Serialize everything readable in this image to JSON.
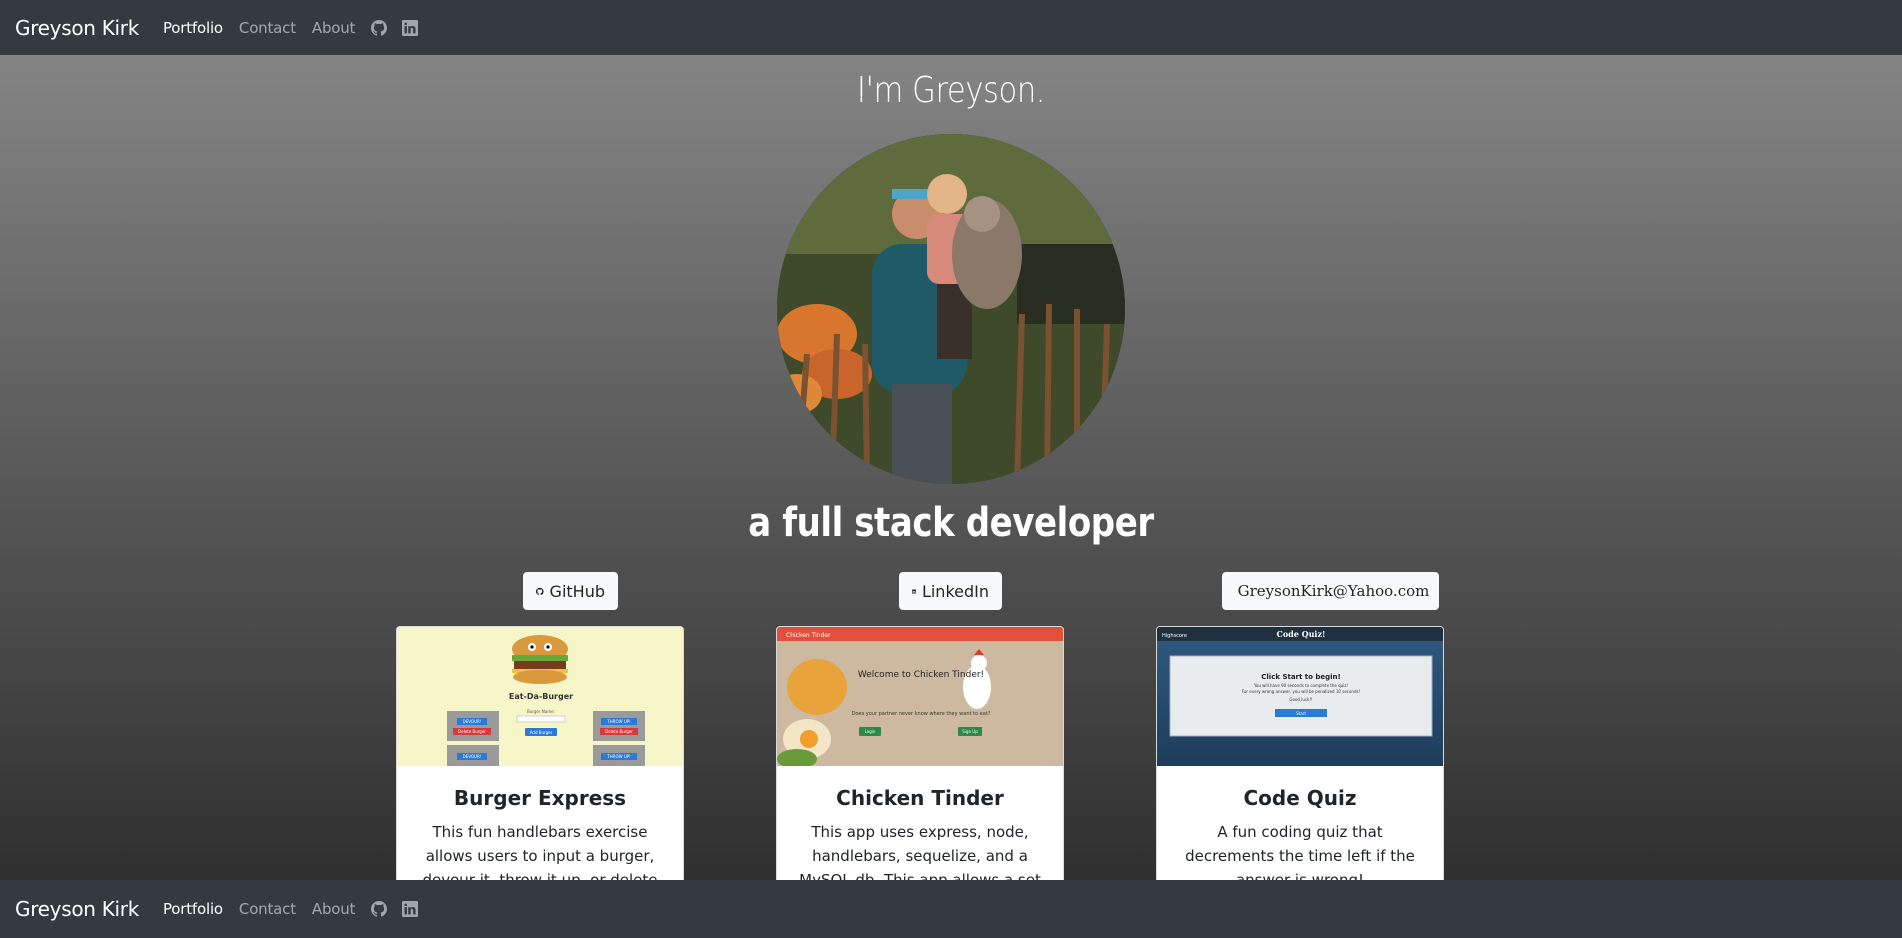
{
  "nav": {
    "brand": "Greyson Kirk",
    "links": [
      {
        "label": "Portfolio",
        "active": true
      },
      {
        "label": "Contact",
        "active": false
      },
      {
        "label": "About",
        "active": false
      }
    ],
    "icons": [
      "github-icon",
      "linkedin-icon"
    ]
  },
  "hero": {
    "title": "I'm Greyson.",
    "subtitle": "a full stack developer"
  },
  "buttons": {
    "github": "GitHub",
    "linkedin": "LinkedIn",
    "email": "GreysonKirk@Yahoo.com"
  },
  "cards": [
    {
      "title": "Burger Express",
      "text": "This fun handlebars exercise allows users to input a burger, devour it, throw it up, or delete it.",
      "thumb": {
        "heading": "Eat-Da-Burger",
        "field_label": "Burger Name:",
        "add_button": "Add Burger",
        "devour_label": "DEVOUR!",
        "delete_label": "Delete Burger",
        "throw_label": "THROW UP!"
      }
    },
    {
      "title": "Chicken Tinder",
      "text": "This app uses express, node, handlebars, sequelize, and a MySQL db. This app allows a set of",
      "thumb": {
        "bar_title": "Chicken Tinder",
        "heading": "Welcome to Chicken Tinder!",
        "question": "Does your partner never know where they want to eat?",
        "login": "Login",
        "signup": "Sign Up"
      }
    },
    {
      "title": "Code Quiz",
      "text": "A fun coding quiz that decrements the time left if the answer is wrong!",
      "thumb": {
        "highscore": "Highscore",
        "bar_title": "Code Quiz!",
        "heading": "Click Start to begin!",
        "line1": "You will have 90 seconds to complete the quiz!",
        "line2": "For every wrong answer, you will be penalized 10 seconds!",
        "line3": "Good luck!!",
        "start": "Start"
      }
    }
  ],
  "colors": {
    "navbar": "#343a40",
    "chicken_bar": "#e2503c",
    "quiz_bar": "#1f3040",
    "burger_bg": "#f7f6c9"
  }
}
